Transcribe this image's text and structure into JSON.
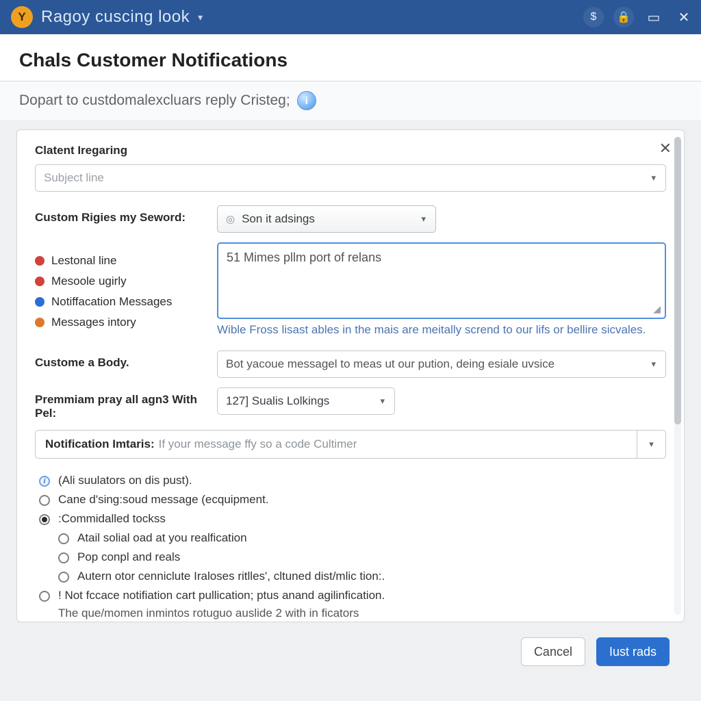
{
  "titlebar": {
    "avatar_letter": "Y",
    "title": "Ragoy cuscing look",
    "icons": [
      "currency",
      "lock",
      "window",
      "close"
    ]
  },
  "page": {
    "heading": "Chals Customer Notifications",
    "subheading": "Dopart to custdomalexcluars reply Cristeg;"
  },
  "panel": {
    "section_label": "Clatent Iregaring",
    "subject_placeholder": "Subject line",
    "custom_rule_label": "Custom Rigies my Seword:",
    "custom_rule_value": "Son it adsings",
    "list_items": [
      {
        "color": "red",
        "label": "Lestonal line"
      },
      {
        "color": "red",
        "label": "Mesoole ugirly"
      },
      {
        "color": "blue",
        "label": "Notiffacation Messages"
      },
      {
        "color": "orange",
        "label": "Messages intory"
      }
    ],
    "textarea_value": "51 Mimes pllm port of relans",
    "textarea_hint": "Wible Fross lisast ables in the mais are meitally scrend to our lifs or bellire sicvales.",
    "body_label": "Custome a Body.",
    "body_value": "Bot yacoue messagel to meas ut our pution, deing esiale uvsice",
    "premium_label": "Premmiam pray all agn3 With Pel:",
    "premium_value": "127] Sualis Lolkings",
    "intaris_prefix": "Notification Imtaris:",
    "intaris_placeholder": "If your message ffy so a code Cultimer",
    "radios": [
      {
        "kind": "info",
        "label": "(Ali suulators on dis pust)."
      },
      {
        "kind": "plain",
        "label": "Cane d'sing:soud message (ecquipment."
      },
      {
        "kind": "checked",
        "label": ":Commidalled tockss"
      },
      {
        "kind": "sub",
        "label": "Atail solial oad at you realfication"
      },
      {
        "kind": "sub",
        "label": "Pop conpl and reals"
      },
      {
        "kind": "sub",
        "label": "Autern otor cenniclute Iraloses ritlles', cltuned dist/mlic tion:."
      },
      {
        "kind": "plain",
        "label": "! Not fccace notifiation cart pullication; ptus anand agilinfication."
      }
    ],
    "trailing_note": "The que/momen inmintos rotuguo auslide 2 with in ficators"
  },
  "footer": {
    "cancel": "Cancel",
    "primary": "Iust rads"
  }
}
